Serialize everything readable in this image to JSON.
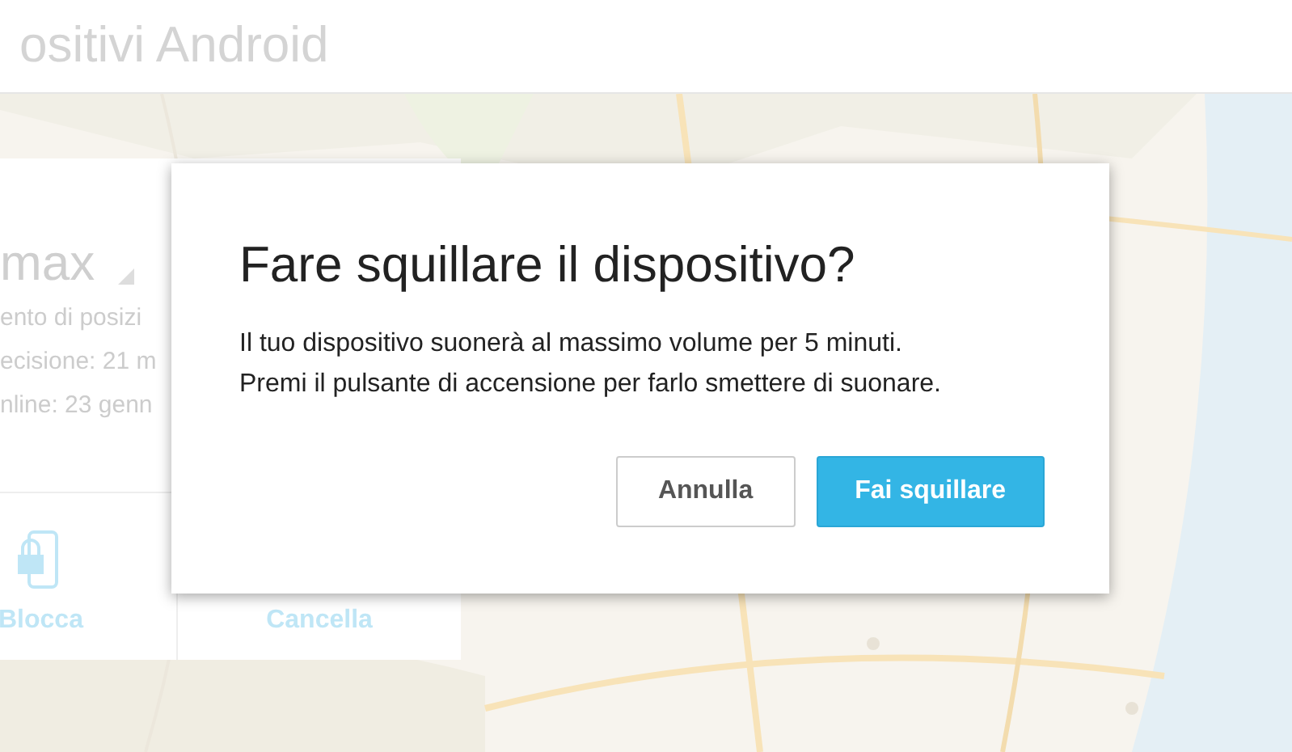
{
  "header": {
    "title": "ositivi Android"
  },
  "device_card": {
    "name": "max",
    "details": [
      "ento di posizi",
      "ecisione: 21 m",
      "nline: 23 genn"
    ],
    "actions": [
      {
        "label": "Blocca",
        "kind": "lock"
      },
      {
        "label": "Cancella",
        "kind": "erase"
      }
    ]
  },
  "dialog": {
    "title": "Fare squillare il dispositivo?",
    "body": [
      "Il tuo dispositivo suonerà al massimo volume per 5 minuti.",
      "Premi il pulsante di accensione per farlo smettere di suonare."
    ],
    "buttons": [
      {
        "label": "Annulla",
        "kind": "secondary"
      },
      {
        "label": "Fai squillare",
        "kind": "primary"
      }
    ]
  }
}
